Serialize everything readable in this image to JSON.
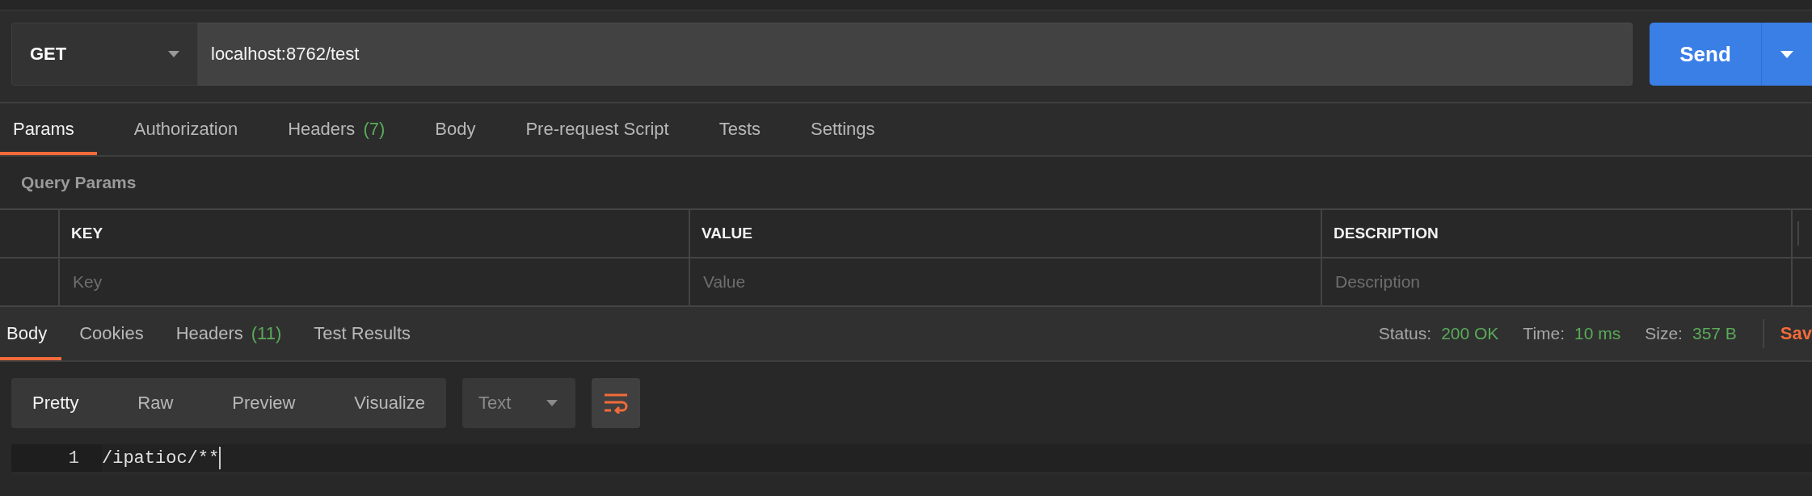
{
  "request": {
    "method": "GET",
    "url": "localhost:8762/test",
    "send_label": "Send"
  },
  "request_tabs": [
    {
      "label": "Params",
      "selected": true
    },
    {
      "label": "Authorization",
      "selected": false
    },
    {
      "label": "Headers",
      "count": "(7)",
      "selected": false
    },
    {
      "label": "Body",
      "selected": false
    },
    {
      "label": "Pre-request Script",
      "selected": false
    },
    {
      "label": "Tests",
      "selected": false
    },
    {
      "label": "Settings",
      "selected": false
    }
  ],
  "query_params": {
    "title": "Query Params",
    "columns": [
      "KEY",
      "VALUE",
      "DESCRIPTION"
    ],
    "placeholders": [
      "Key",
      "Value",
      "Description"
    ]
  },
  "response_tabs": [
    {
      "label": "Body",
      "selected": true
    },
    {
      "label": "Cookies",
      "selected": false
    },
    {
      "label": "Headers",
      "count": "(11)",
      "selected": false
    },
    {
      "label": "Test Results",
      "selected": false
    }
  ],
  "response_stats": [
    {
      "label": "Status:",
      "value": "200 OK"
    },
    {
      "label": "Time:",
      "value": "10 ms"
    },
    {
      "label": "Size:",
      "value": "357 B"
    }
  ],
  "save_label": "Sav",
  "format_modes": [
    {
      "label": "Pretty",
      "selected": true
    },
    {
      "label": "Raw",
      "selected": false
    },
    {
      "label": "Preview",
      "selected": false
    },
    {
      "label": "Visualize",
      "selected": false
    }
  ],
  "body_type": "Text",
  "wrap_on": true,
  "editor_lines": [
    {
      "number": "1",
      "text": "/ipatioc/**"
    }
  ]
}
